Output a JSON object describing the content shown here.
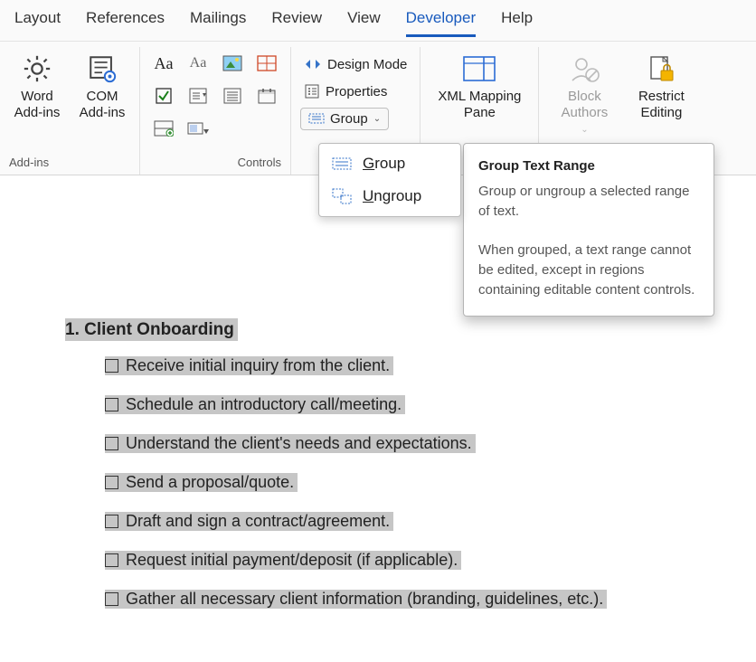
{
  "tabs": {
    "items": [
      "Layout",
      "References",
      "Mailings",
      "Review",
      "View",
      "Developer",
      "Help"
    ],
    "active_index": 5
  },
  "ribbon": {
    "addins": {
      "word": "Word Add-ins",
      "com": "COM Add-ins",
      "group_label": "Add-ins"
    },
    "controls": {
      "group_label": "Controls",
      "design_mode": "Design Mode",
      "properties": "Properties",
      "group_btn": "Group"
    },
    "mapping": {
      "label": "XML Mapping Pane"
    },
    "protect": {
      "block": "Block Authors",
      "restrict": "Restrict Editing"
    }
  },
  "dropdown": {
    "group": "Group",
    "ungroup": "Ungroup"
  },
  "tooltip": {
    "title": "Group Text Range",
    "line1": "Group or ungroup a selected range of text.",
    "line2": "When grouped, a text range cannot be edited, except in regions containing editable content controls."
  },
  "document": {
    "heading": "1. Client Onboarding",
    "items": [
      " Receive initial inquiry from the client.",
      " Schedule an introductory call/meeting.",
      " Understand the client's needs and expectations.",
      "Send a proposal/quote.",
      "Draft and sign a contract/agreement.",
      "Request initial payment/deposit (if applicable).",
      "Gather all necessary client information (branding, guidelines, etc.)."
    ]
  }
}
